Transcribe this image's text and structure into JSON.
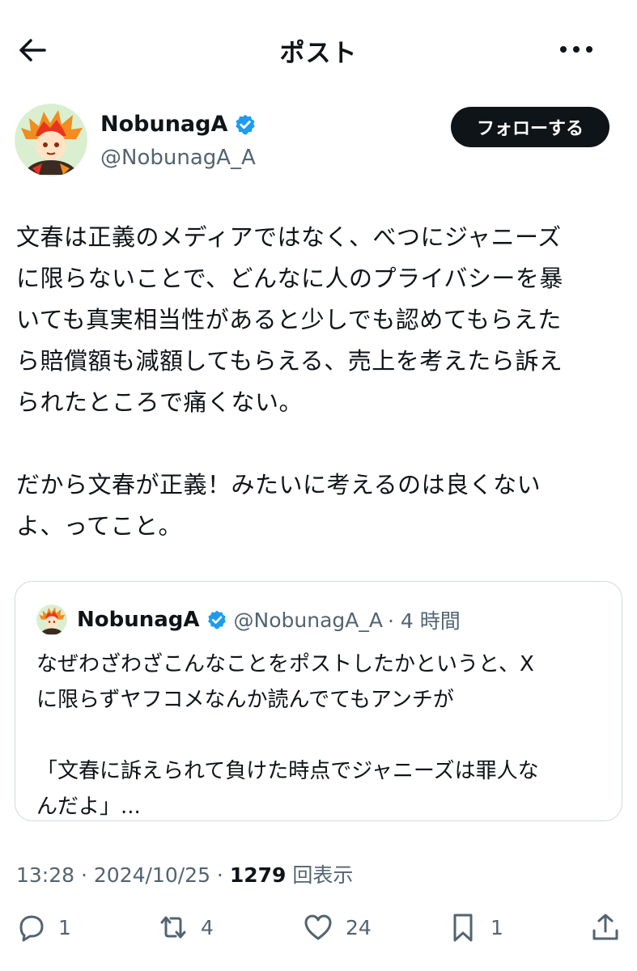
{
  "header": {
    "title": "ポスト"
  },
  "author": {
    "name": "NobunagA",
    "handle": "@NobunagA_A",
    "follow_label": "フォローする"
  },
  "post": {
    "text": "文春は正義のメディアではなく、べつにジャニーズ\nに限らないことで、どんなに人のプライバシーを暴\nいても真実相当性があると少しでも認めてもらえた\nら賠償額も減額してもらえる、売上を考えたら訴え\nられたところで痛くない。\n\nだから文春が正義！みたいに考えるのは良くない\nよ、ってこと。"
  },
  "quote": {
    "name": "NobunagA",
    "handle": "@NobunagA_A",
    "time": "· 4 時間",
    "text": "なぜわざわざこんなことをポストしたかというと、X\nに限らずヤフコメなんか読んでてもアンチが\n\n「文春に訴えられて負けた時点でジャニーズは罪人な\nんだよ」..."
  },
  "meta": {
    "time": "13:28 · 2024/10/25 · ",
    "views": "1279",
    "views_label": " 回表示"
  },
  "actions": {
    "reply_count": "1",
    "repost_count": "4",
    "like_count": "24",
    "bookmark_count": "1"
  },
  "colors": {
    "verified": "#1d9bf0",
    "follow_bg": "#0f1419",
    "muted": "#536471",
    "border": "#cfd9de"
  },
  "icons": [
    "back-arrow-icon",
    "more-icon",
    "verified-icon",
    "reply-icon",
    "repost-icon",
    "like-icon",
    "bookmark-icon",
    "share-icon"
  ]
}
